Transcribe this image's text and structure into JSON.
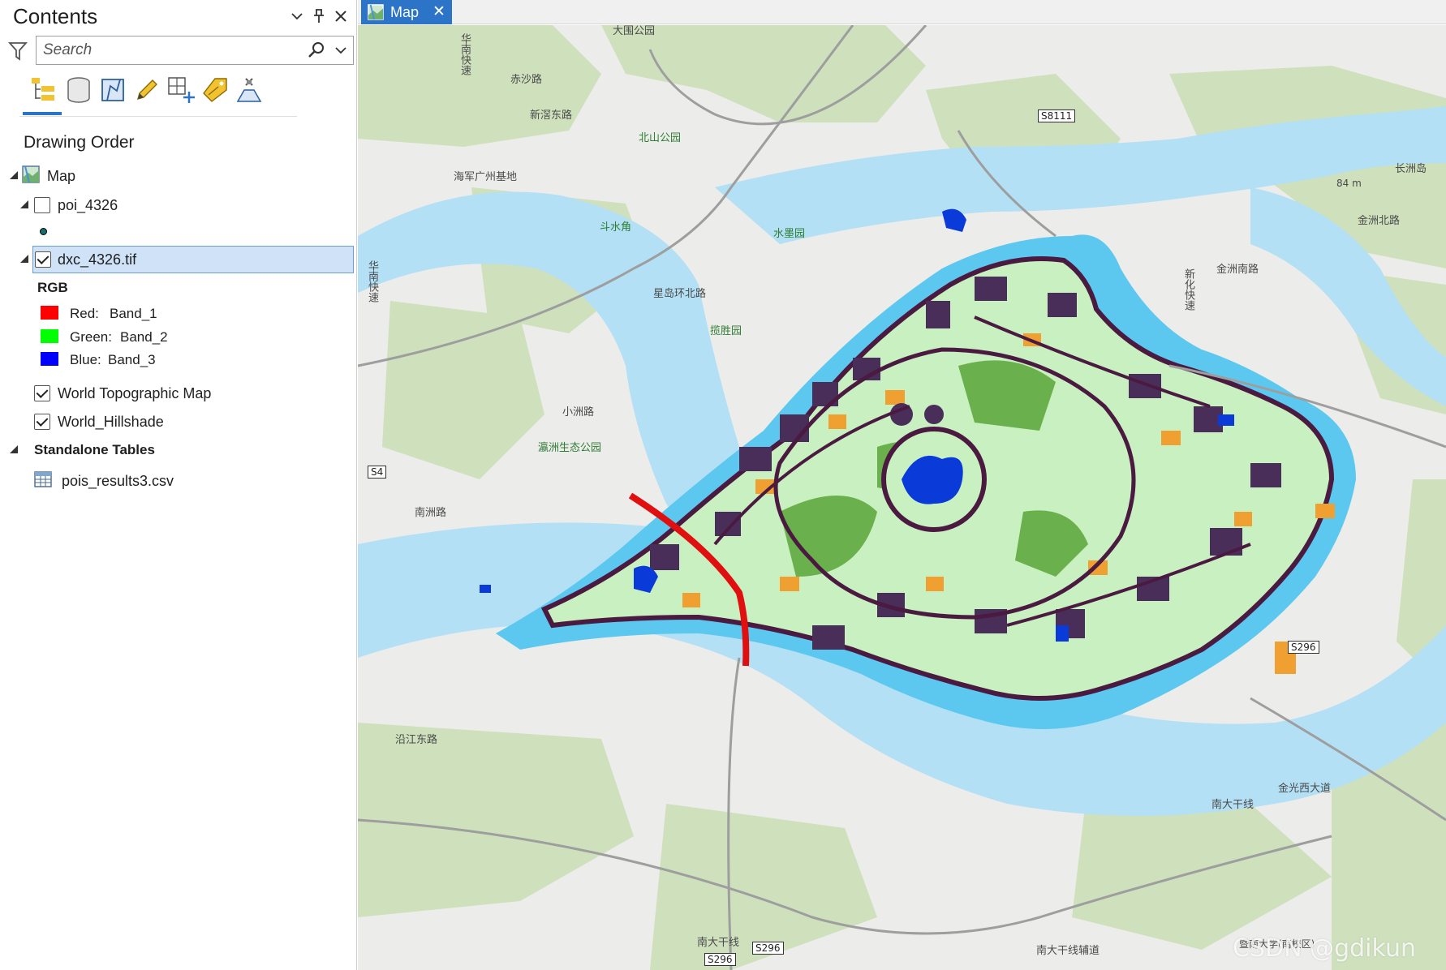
{
  "contents_pane": {
    "title": "Contents",
    "search": {
      "placeholder": "Search"
    },
    "toolbar": [
      "list-by-drawing-order-icon",
      "list-by-data-source-icon",
      "list-by-selection-icon",
      "list-by-editing-icon",
      "list-by-snapping-icon",
      "list-by-labeling-icon",
      "list-by-perspective-imagery-icon"
    ],
    "section_title": "Drawing Order",
    "tree": {
      "map_label": "Map",
      "poi_layer": "poi_4326",
      "raster_layer": "dxc_4326.tif",
      "rgb_heading": "RGB",
      "bands": [
        {
          "channel": "Red:",
          "band": "Band_1",
          "color": "#ff0000"
        },
        {
          "channel": "Green:",
          "band": "Band_2",
          "color": "#00ff00"
        },
        {
          "channel": "Blue:",
          "band": "Band_3",
          "color": "#0000ff"
        }
      ],
      "topo_layer": "World Topographic Map",
      "hillshade_layer": "World_Hillshade",
      "standalone_heading": "Standalone Tables",
      "table_name": "pois_results3.csv"
    }
  },
  "map_view": {
    "tab_label": "Map",
    "labels": {
      "dawei_park": "大围公园",
      "chisha_rd": "赤沙路",
      "xinjiao_east_rd": "新滘东路",
      "huanan_exp_1": "华南快速",
      "beishan_park": "北山公园",
      "haijun_base": "海军广州基地",
      "doushuijiao": "斗水角",
      "shuimo_garden": "水墨园",
      "guanshen_garden": "揽胜园",
      "huandao_north_rd": "星岛环北路",
      "xiaozhou_rd": "小洲路",
      "yingzhou_park": "瀛洲生态公园",
      "nanzhou_rd": "南洲路",
      "huanan_exp_2": "华南快速",
      "changzhou_island": "长洲岛",
      "jinzhou_north_rd": "金洲北路",
      "jinzhou_south_rd": "金洲南路",
      "xinhua_exp": "新化快速",
      "elev": "84 m",
      "yanjiang_east_rd": "沿江东路",
      "nanda_rd_1": "南大干线",
      "nanda_rd_2": "南大干线",
      "nanda_rd_3": "南大干线辅道",
      "jinguang_west": "金光西大道",
      "jinan_univ": "暨南大学(南校区)",
      "watermark": "CSDN @gdikun"
    },
    "shields": {
      "s8111": "S8111",
      "s4": "S4",
      "s296_a": "S296",
      "s296_b": "S296",
      "s296_c": "S296"
    }
  }
}
